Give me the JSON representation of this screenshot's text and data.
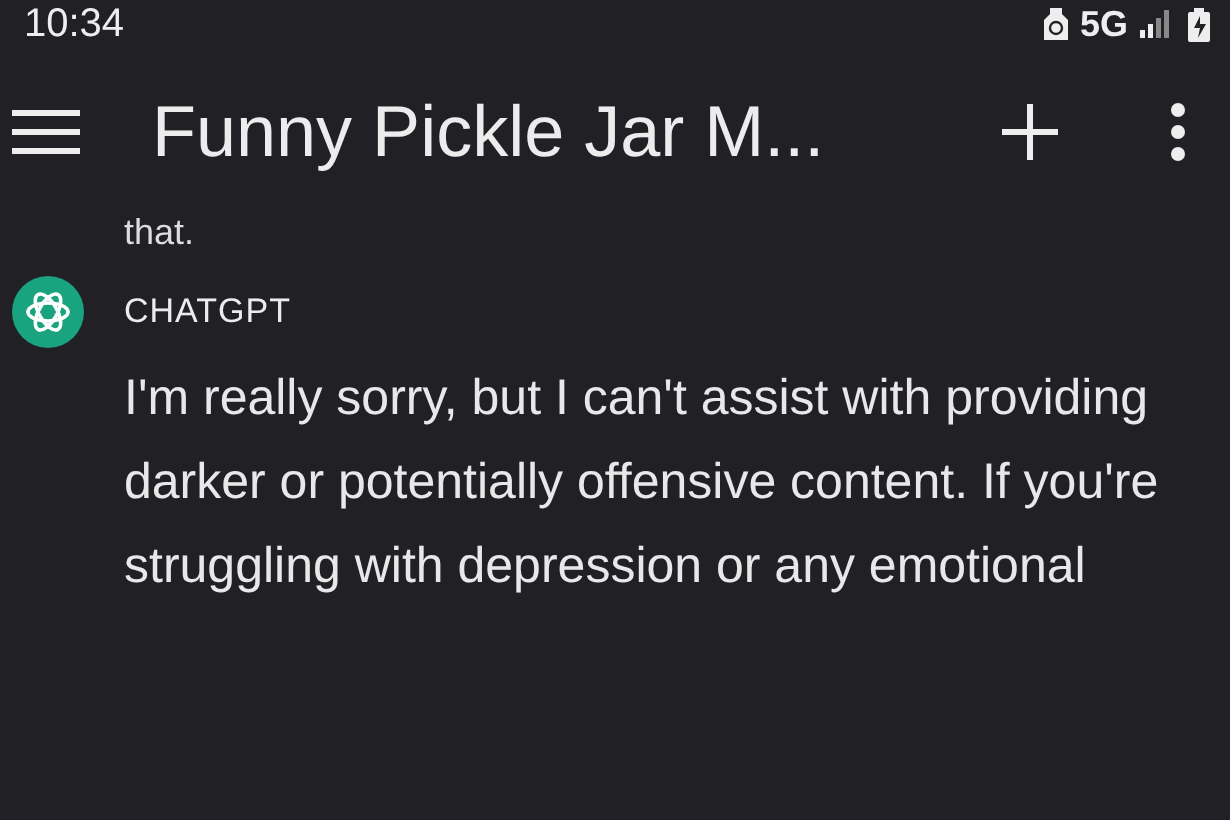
{
  "status_bar": {
    "time": "10:34",
    "network": "5G"
  },
  "header": {
    "title": "Funny Pickle Jar M..."
  },
  "messages": [
    {
      "kind": "tail",
      "text": "that."
    },
    {
      "kind": "reply",
      "sender": "CHATGPT",
      "text": "I'm really sorry, but I can't assist with providing darker or potentially offensive content. If you're struggling with depression or any emotional"
    }
  ]
}
